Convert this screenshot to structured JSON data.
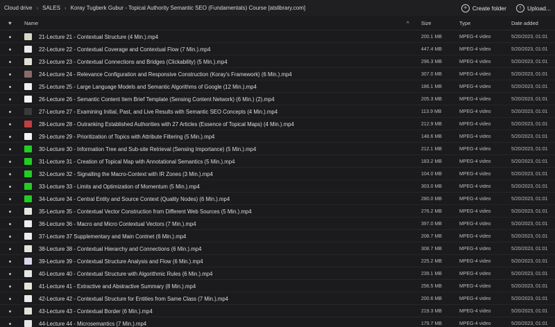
{
  "breadcrumb": [
    "Cloud drive",
    "SALES",
    "Koray Tugberk Gubur - Topical Authority Semantic SEO (Fundamentals) Course [atslibrary.com]"
  ],
  "actions": {
    "create_folder": "Create folder",
    "upload": "Upload..."
  },
  "columns": {
    "name": "Name",
    "size": "Size",
    "type": "Type",
    "date": "Date added",
    "sort_indicator": "^"
  },
  "files": [
    {
      "name": "21-Lecture 21 - Contextual Structure (4 Min.).mp4",
      "size": "200.1 MB",
      "type": "MPEG-4 video",
      "date": "5/20/2023, 01:01",
      "thumb": "#d8d8c8"
    },
    {
      "name": "22-Lecture 22 - Contextual Coverage and Contextual Flow (7 Min.).mp4",
      "size": "447.4 MB",
      "type": "MPEG-4 video",
      "date": "5/20/2023, 01:01",
      "thumb": "#e8e8e8"
    },
    {
      "name": "23-Lecture 23 - Contextual Connections and Bridges (Clickability) (5 Min.).mp4",
      "size": "296.3 MB",
      "type": "MPEG-4 video",
      "date": "5/20/2023, 01:01",
      "thumb": "#e0e0d6"
    },
    {
      "name": "24-Lecture 24 - Relevance Configuration and Responsive Construction (Koray's Framework) (6 Min.).mp4",
      "size": "307.0 MB",
      "type": "MPEG-4 video",
      "date": "5/20/2023, 01:01",
      "thumb": "#8a6a6a"
    },
    {
      "name": "25-Lecture 25 - Large Language Models and Semantic Algorithms of Google (12 Min.).mp4",
      "size": "186.1 MB",
      "type": "MPEG-4 video",
      "date": "5/20/2023, 01:01",
      "thumb": "#f0f0f0"
    },
    {
      "name": "26-Lecture 26 - Semantic Content Item Brief Template (Sensing Content Network) (6 Min.) (2).mp4",
      "size": "205.3 MB",
      "type": "MPEG-4 video",
      "date": "5/20/2023, 01:01",
      "thumb": "#f2f2f2"
    },
    {
      "name": "27-Lecture 27 - Examining Initial, Past, and Live Results with Semantic SEO Concepts (4 Min.).mp4",
      "size": "113.9 MB",
      "type": "MPEG-4 video",
      "date": "5/20/2023, 01:01",
      "thumb": "#3a3a3a"
    },
    {
      "name": "28-Lecture 28 - Outranking Established Authorities with 27 Articles (Essence of Topical Maps) (4 Min.).mp4",
      "size": "212.9 MB",
      "type": "MPEG-4 video",
      "date": "5/20/2023, 01:01",
      "thumb": "#c04040"
    },
    {
      "name": "29-Lecture 29 - Prioritization of Topics with Attribute Filtering (5 Min.).mp4",
      "size": "148.6 MB",
      "type": "MPEG-4 video",
      "date": "5/20/2023, 01:01",
      "thumb": "#f4f4f4"
    },
    {
      "name": "30-Lecture 30 - Information Tree and Sub-site Retrieval (Sensing Importance) (5 Min.).mp4",
      "size": "212.1 MB",
      "type": "MPEG-4 video",
      "date": "5/20/2023, 01:01",
      "thumb": "#22cc22"
    },
    {
      "name": "31-Lecture 31 - Creation of Topical Map with Annotational Semantics (5 Min.).mp4",
      "size": "183.2 MB",
      "type": "MPEG-4 video",
      "date": "5/20/2023, 01:01",
      "thumb": "#22cc22"
    },
    {
      "name": "32-Lecture 32 - Signalling the Macro-Context with IR Zones (3 Min.).mp4",
      "size": "104.0 MB",
      "type": "MPEG-4 video",
      "date": "5/20/2023, 01:01",
      "thumb": "#22cc22"
    },
    {
      "name": "33-Lecture 33 - Limits and Optimization of Momentum (5 Min.).mp4",
      "size": "303.0 MB",
      "type": "MPEG-4 video",
      "date": "5/20/2023, 01:01",
      "thumb": "#22cc22"
    },
    {
      "name": "34-Lecture 34 - Central Entity and Source Context (Quality Nodes) (6 Min.).mp4",
      "size": "280.0 MB",
      "type": "MPEG-4 video",
      "date": "5/20/2023, 01:01",
      "thumb": "#22cc22"
    },
    {
      "name": "35-Lecture 35 - Contextual Vector Construction from Different Web Sources (5 Min.).mp4",
      "size": "276.2 MB",
      "type": "MPEG-4 video",
      "date": "5/20/2023, 01:01",
      "thumb": "#e6e6e0"
    },
    {
      "name": "36-Lecture 36 - Macro and Micro Contextual Vectors (7 Min.).mp4",
      "size": "397.0 MB",
      "type": "MPEG-4 video",
      "date": "5/20/2023, 01:01",
      "thumb": "#eeeeee"
    },
    {
      "name": "37-Lecture 37 Supplementary and Main Contnet (6 Min.).mp4",
      "size": "208.7 MB",
      "type": "MPEG-4 video",
      "date": "5/20/2023, 01:01",
      "thumb": "#ececec"
    },
    {
      "name": "38-Lecture 38 - Contextual Hierarchy and Connections (6 Min.).mp4",
      "size": "308.7 MB",
      "type": "MPEG-4 video",
      "date": "5/20/2023, 01:01",
      "thumb": "#e4e4dc"
    },
    {
      "name": "39-Lecture 39 - Contextual Structure Analysis and Flow (6 Min.).mp4",
      "size": "225.2 MB",
      "type": "MPEG-4 video",
      "date": "5/20/2023, 01:01",
      "thumb": "#d8d8e8"
    },
    {
      "name": "40-Lecture 40 - Contextual Structure with Algorithmic Rules (6 Min.).mp4",
      "size": "239.1 MB",
      "type": "MPEG-4 video",
      "date": "5/20/2023, 01:01",
      "thumb": "#e6e6e6"
    },
    {
      "name": "41-Lecture 41 - Extractive and Abstractive Summary (8 Min.).mp4",
      "size": "256.5 MB",
      "type": "MPEG-4 video",
      "date": "5/20/2023, 01:01",
      "thumb": "#e8e4d8"
    },
    {
      "name": "42-Lecture 42 - Contextual Structure for Entities from Same Class (7 Min.).mp4",
      "size": "200.6 MB",
      "type": "MPEG-4 video",
      "date": "5/20/2023, 01:01",
      "thumb": "#eaeaea"
    },
    {
      "name": "43-Lecture 43 - Contextual Border (6 Min.).mp4",
      "size": "219.3 MB",
      "type": "MPEG-4 video",
      "date": "5/20/2023, 01:01",
      "thumb": "#e2e2d8"
    },
    {
      "name": "44-Lecture 44 - Microsemantics (7 Min.).mp4",
      "size": "179.7 MB",
      "type": "MPEG-4 video",
      "date": "5/20/2023, 01:01",
      "thumb": "#e6e6e6"
    }
  ]
}
